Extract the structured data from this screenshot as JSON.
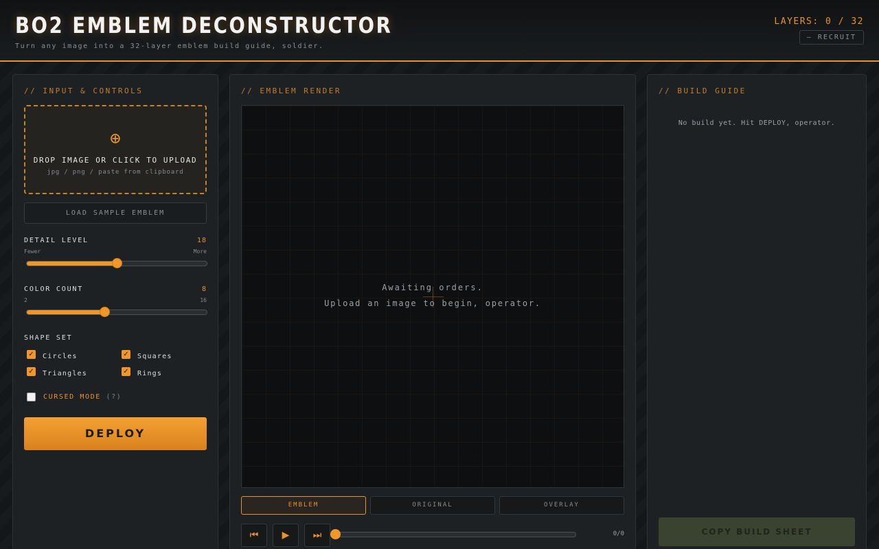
{
  "header": {
    "title": "BO2 EMBLEM DECONSTRUCTOR",
    "subtitle": "Turn any image into a 32-layer emblem build guide, soldier.",
    "layers": "LAYERS: 0 / 32",
    "rank": "— RECRUIT"
  },
  "controls": {
    "title": "// INPUT & CONTROLS",
    "dropzone": {
      "icon": "⊕",
      "label": "DROP IMAGE OR CLICK TO UPLOAD",
      "hint": "jpg / png / paste from clipboard"
    },
    "sample_button": "LOAD SAMPLE EMBLEM",
    "detail": {
      "label": "DETAIL LEVEL",
      "value": "18",
      "min_label": "Fewer",
      "max_label": "More",
      "fraction": 0.5
    },
    "colors": {
      "label": "COLOR COUNT",
      "value": "8",
      "min_label": "2",
      "max_label": "16",
      "fraction": 0.43
    },
    "shape_set": {
      "label": "SHAPE SET",
      "circles": "Circles",
      "squares": "Squares",
      "triangles": "Triangles",
      "rings": "Rings",
      "check": "✓"
    },
    "cursed": {
      "label": "CURSED MODE",
      "hint": "(?)"
    },
    "deploy": "DEPLOY"
  },
  "render": {
    "title": "// EMBLEM RENDER",
    "await_line1": "Awaiting orders.",
    "await_line2": "Upload an image to begin, operator.",
    "tabs": [
      "EMBLEM",
      "ORIGINAL",
      "OVERLAY"
    ],
    "rewind_icon": "⏮",
    "play_icon": "▶",
    "forward_icon": "⏭",
    "frame_count": "0/0"
  },
  "guide": {
    "title": "// BUILD GUIDE",
    "empty": "No build yet. Hit DEPLOY, operator.",
    "copy_button": "COPY BUILD SHEET"
  },
  "colors": {
    "accent": "#e8922a",
    "background": "#15181a",
    "panel": "#1d2124"
  }
}
